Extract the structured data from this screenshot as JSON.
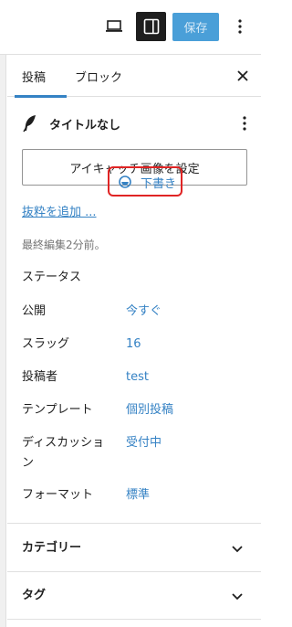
{
  "toolbar": {
    "save_label": "保存",
    "icons": [
      "laptop-icon",
      "sidebar-panel-icon",
      "more-vertical-icon"
    ]
  },
  "tabs": {
    "post": "投稿",
    "block": "ブロック"
  },
  "post": {
    "title": "タイトルなし",
    "featured_image_button": "アイキャッチ画像を設定",
    "excerpt_link": "抜粋を追加 ...",
    "last_edited": "最終編集2分前。"
  },
  "meta": {
    "status": {
      "label": "ステータス",
      "value": "下書き"
    },
    "publish": {
      "label": "公開",
      "value": "今すぐ"
    },
    "slug": {
      "label": "スラッグ",
      "value": "16"
    },
    "author": {
      "label": "投稿者",
      "value": "test"
    },
    "template": {
      "label": "テンプレート",
      "value": "個別投稿"
    },
    "discussion": {
      "label": "ディスカッション",
      "value": "受付中"
    },
    "format": {
      "label": "フォーマット",
      "value": "標準"
    }
  },
  "panels": {
    "categories": "カテゴリー",
    "tags": "タグ"
  },
  "colors": {
    "accent": "#3582c4",
    "save_bg": "#4a9fd8",
    "highlight": "#e02424"
  }
}
